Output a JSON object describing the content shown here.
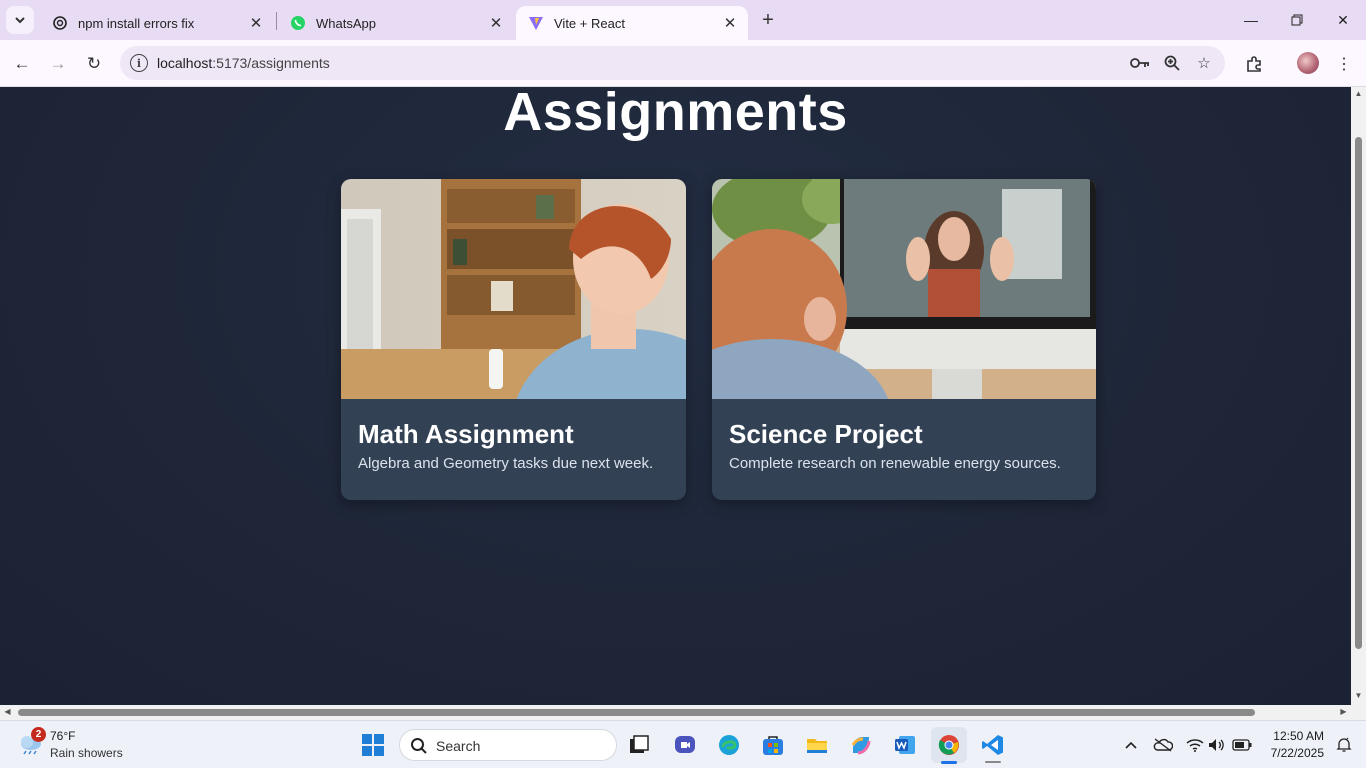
{
  "browser": {
    "tabs": [
      {
        "title": "npm install errors fix",
        "icon": "openai-icon"
      },
      {
        "title": "WhatsApp",
        "icon": "whatsapp-icon"
      },
      {
        "title": "Vite + React",
        "icon": "vite-icon",
        "active": true
      }
    ],
    "address": {
      "host": "localhost",
      "port_path": ":5173/assignments"
    }
  },
  "page": {
    "title": "Assignments",
    "cards": [
      {
        "title": "Math Assignment",
        "description": "Algebra and Geometry tasks due next week."
      },
      {
        "title": "Science Project",
        "description": "Complete research on renewable energy sources."
      }
    ]
  },
  "taskbar": {
    "weather": {
      "badge": "2",
      "temp": "76°F",
      "desc": "Rain showers"
    },
    "search_label": "Search",
    "clock": {
      "time": "12:50 AM",
      "date": "7/22/2025"
    }
  },
  "colors": {
    "page_bg": "#1e293b",
    "card_bg": "#334155",
    "title_text": "#ffffff",
    "desc_text": "#dbe2ec"
  }
}
